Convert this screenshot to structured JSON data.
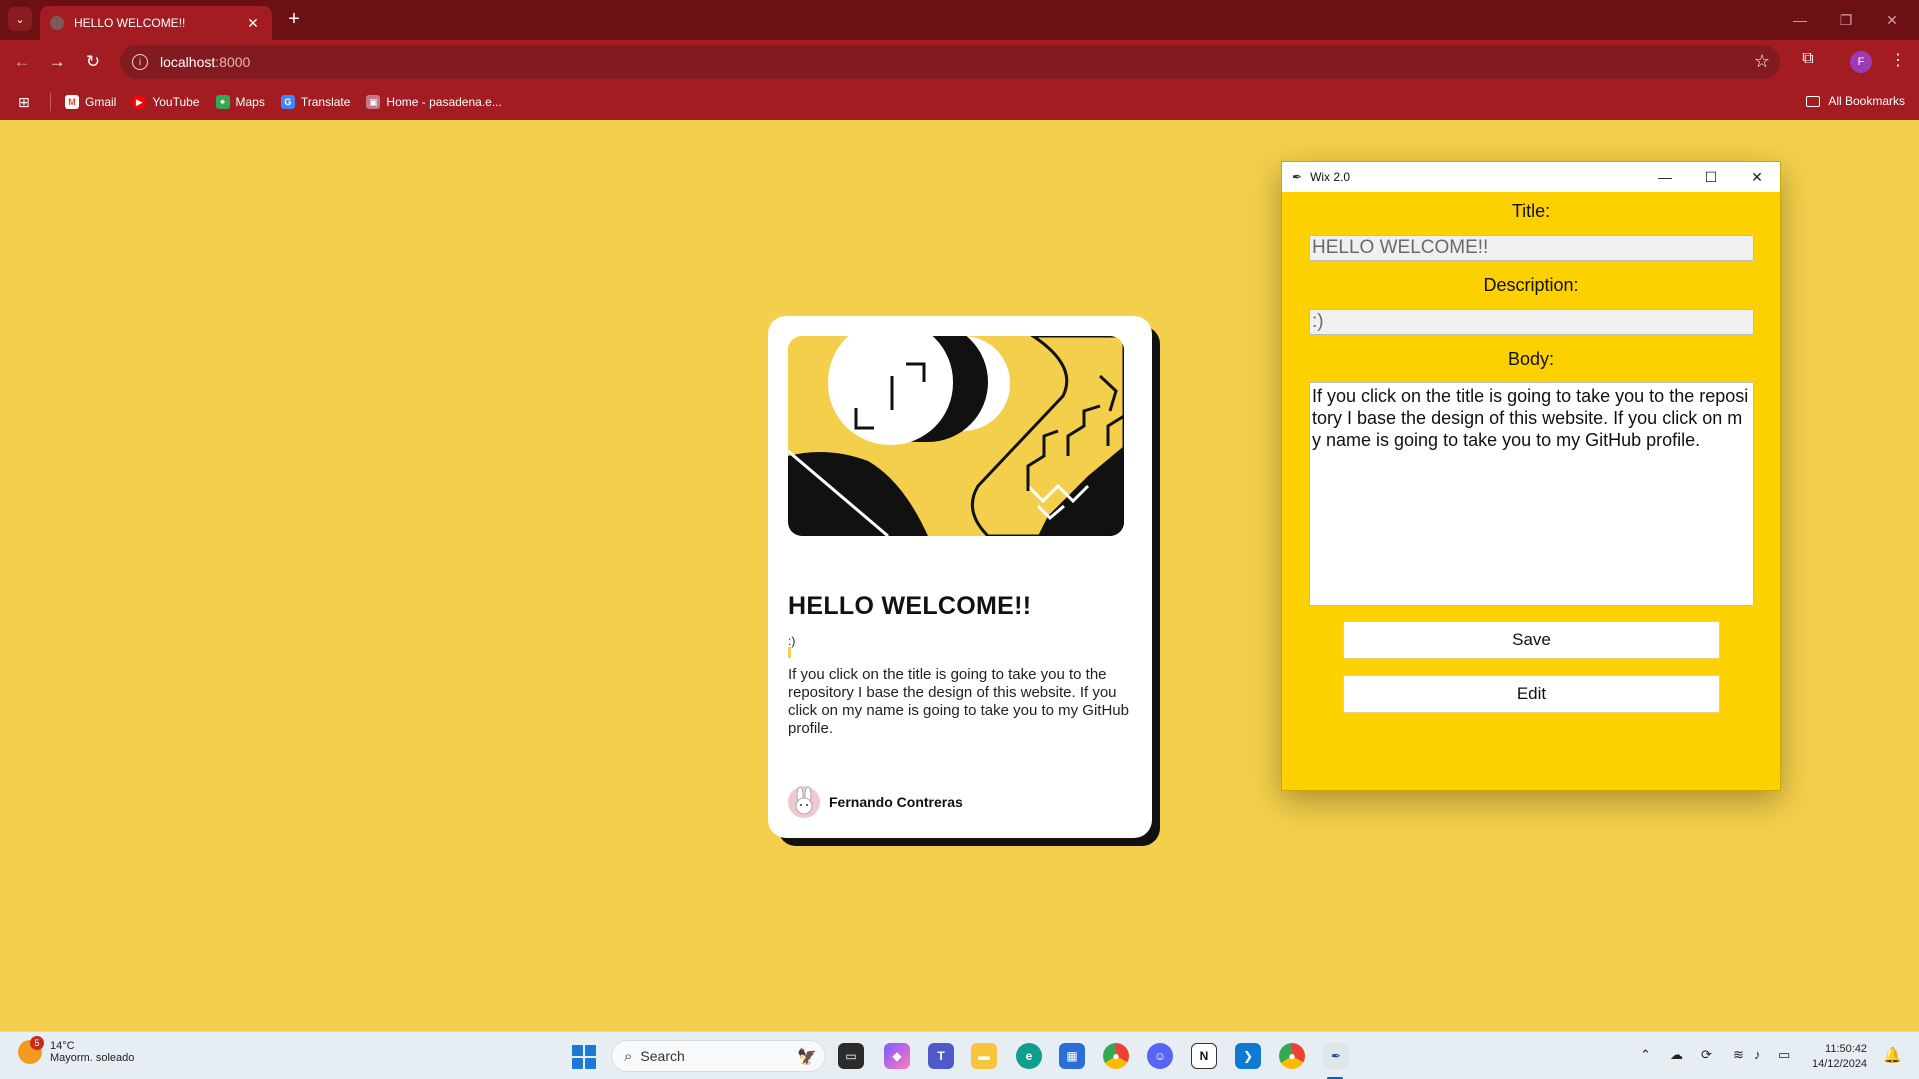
{
  "browser": {
    "tab_title": "HELLO WELCOME!!",
    "tab_close": "✕",
    "new_tab": "+",
    "url_host": "localhost",
    "url_port": ":8000",
    "window_minimize": "—",
    "window_restore": "❐",
    "window_close": "✕",
    "profile_initial": "F",
    "bookmarks": [
      {
        "label": "Gmail"
      },
      {
        "label": "YouTube"
      },
      {
        "label": "Maps"
      },
      {
        "label": "Translate"
      },
      {
        "label": "Home - pasadena.e..."
      }
    ],
    "all_bookmarks": "All Bookmarks"
  },
  "card": {
    "title": "HELLO WELCOME!!",
    "description": ":)",
    "body": "If you click on the title is going to take you to the repository I base the design of this website. If you click on my name is going to take you to my GitHub profile.",
    "author": "Fernando Contreras"
  },
  "wix": {
    "window_title": "Wix 2.0",
    "minimize": "—",
    "maximize": "☐",
    "close": "✕",
    "title_label": "Title:",
    "title_value": "HELLO WELCOME!!",
    "description_label": "Description:",
    "description_value": ":)",
    "body_label": "Body:",
    "body_value": "If you click on the title is going to take you to the repository I base the design of this website. If you click on my name is going to take you to my GitHub profile.",
    "save_label": "Save",
    "edit_label": "Edit"
  },
  "taskbar": {
    "weather_badge": "5",
    "temperature": "14°C",
    "weather_text": "Mayorm. soleado",
    "search_placeholder": "Search",
    "time": "11:50:42",
    "date": "14/12/2024"
  },
  "colors": {
    "page_background": "#f4cf4b",
    "browser_chrome": "#a31c22",
    "tab_strip": "#6c1014",
    "wix_background": "#fdd000"
  }
}
